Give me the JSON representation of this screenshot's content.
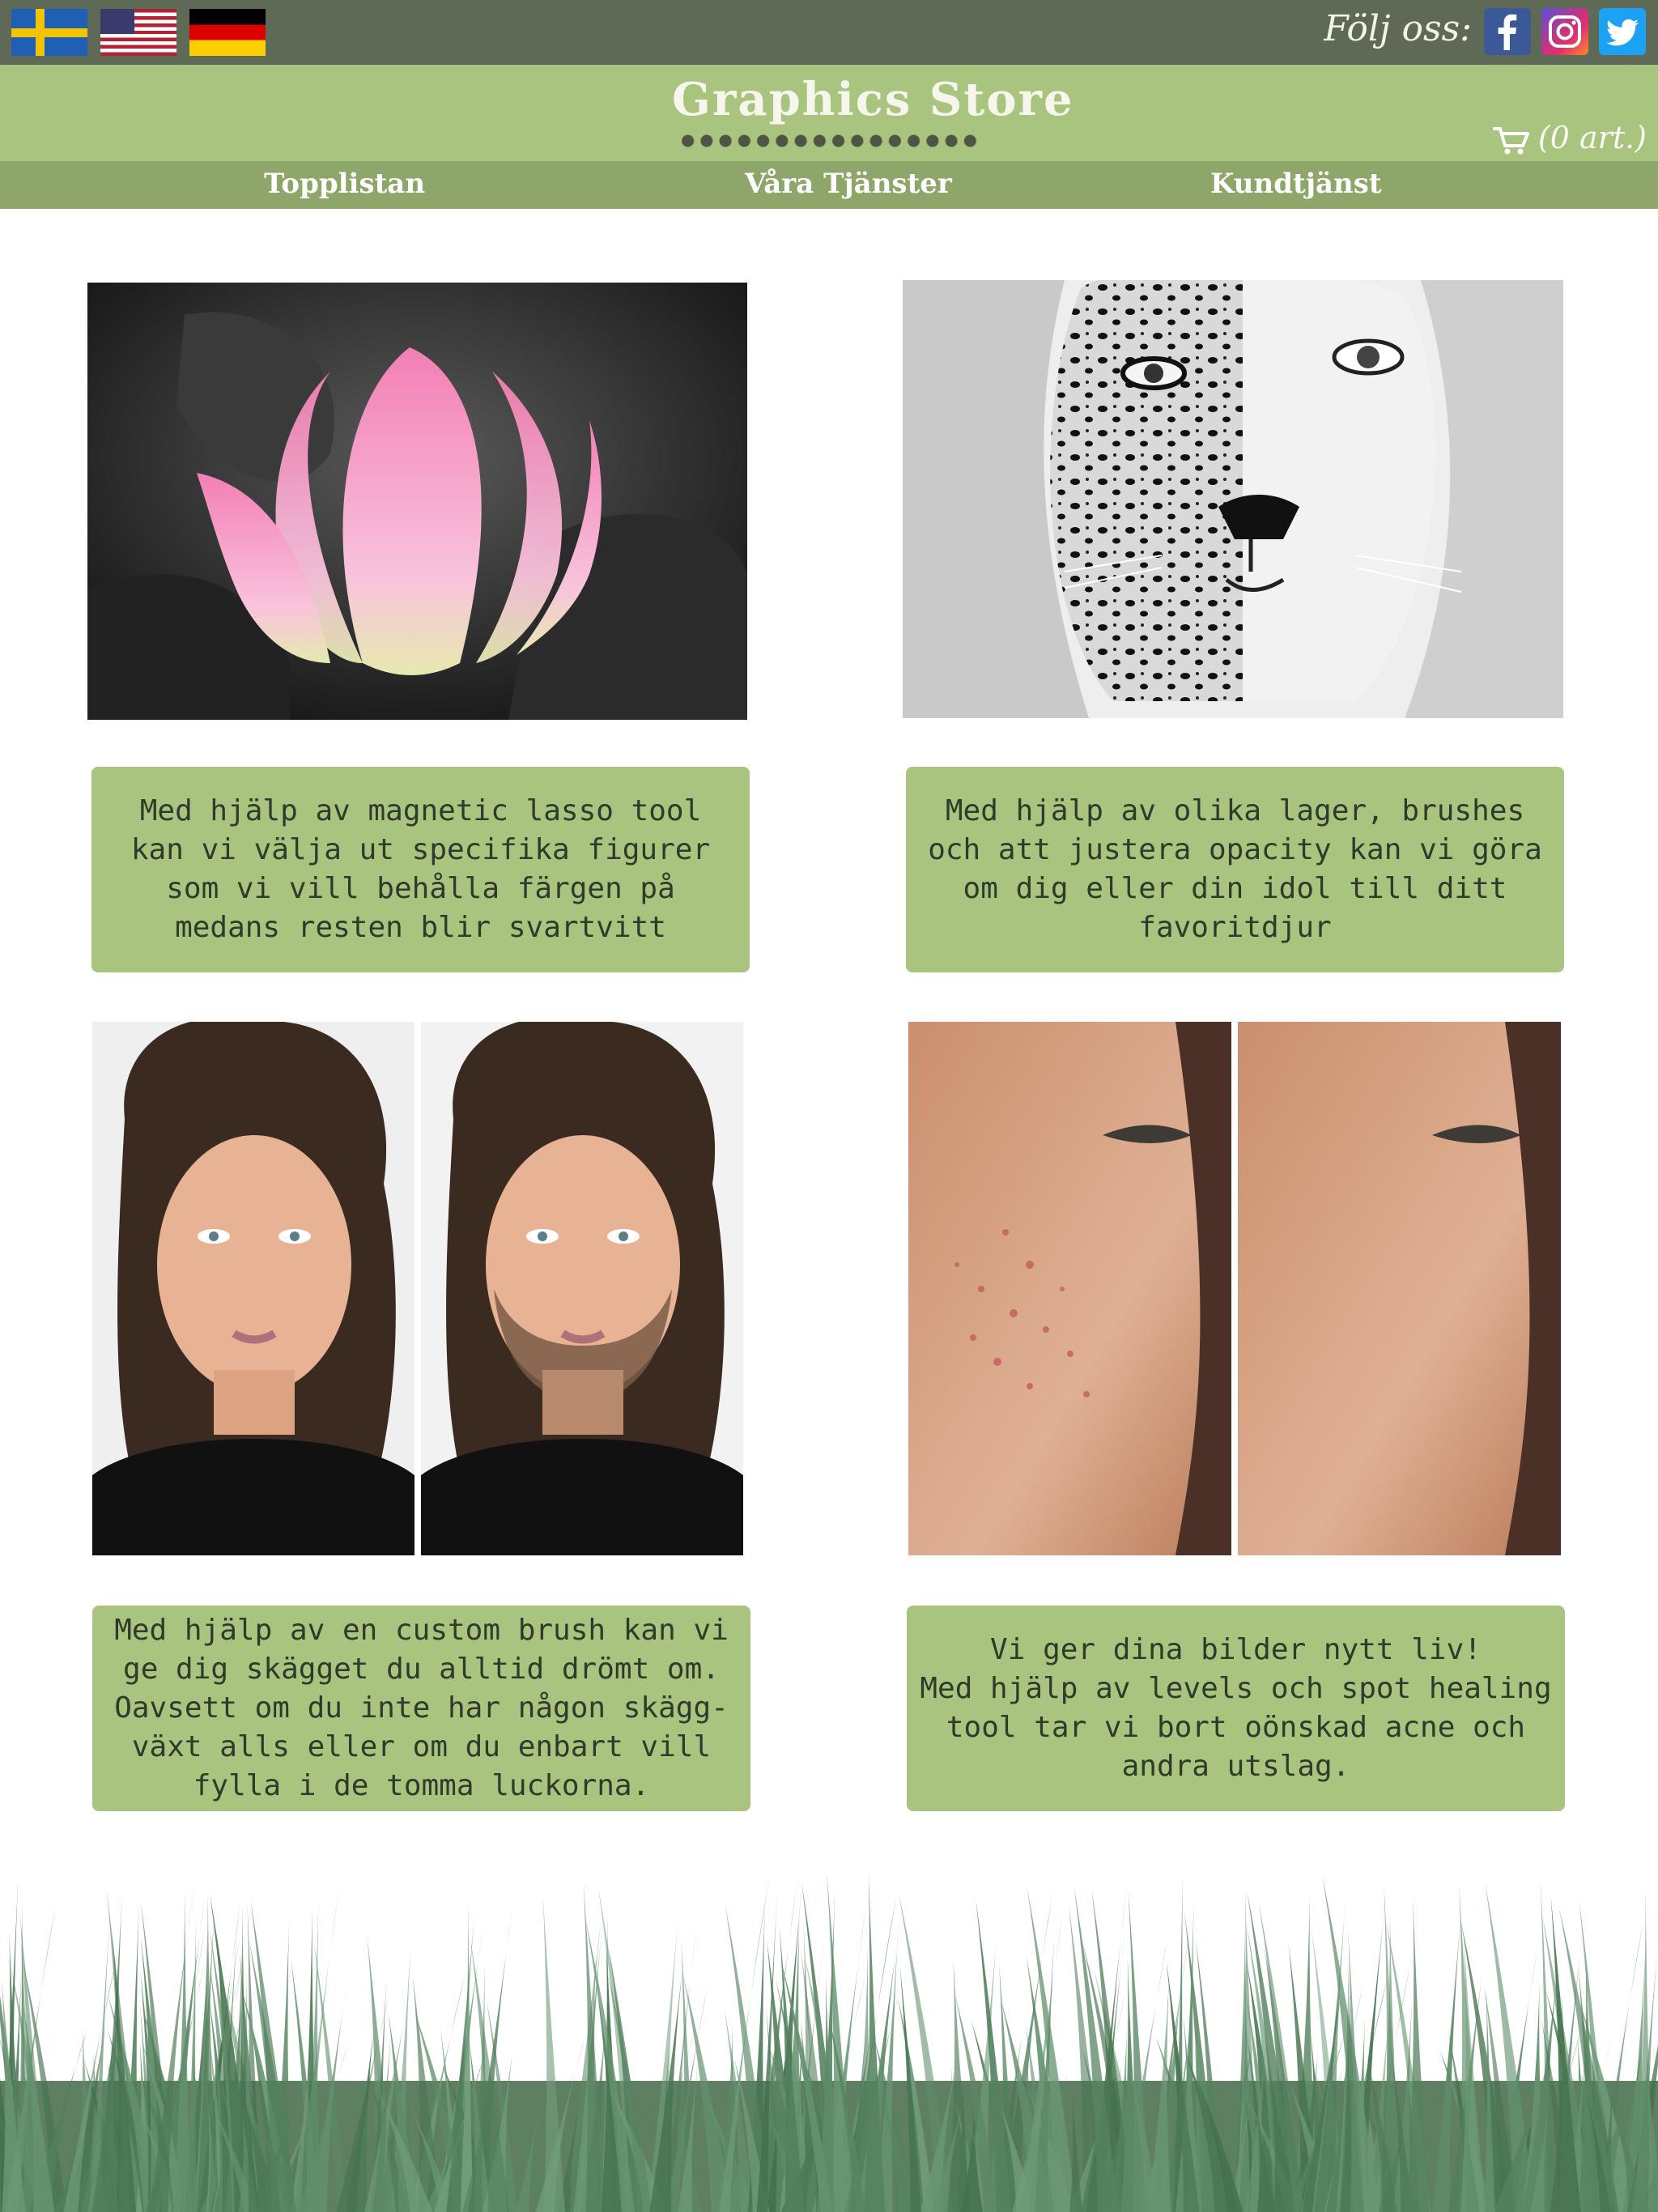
{
  "topbar": {
    "flags": [
      {
        "name": "Sverige",
        "icon": "flag-se-icon"
      },
      {
        "name": "USA",
        "icon": "flag-us-icon"
      },
      {
        "name": "Deutschland",
        "icon": "flag-de-icon"
      }
    ],
    "follow_label": "Följ oss:",
    "social": [
      "facebook-icon",
      "instagram-icon",
      "twitter-icon"
    ]
  },
  "header": {
    "logo": "Graphics Store",
    "cart": "(0 art.)"
  },
  "nav": {
    "items": [
      "Topplistan",
      "Våra Tjänster",
      "Kundtjänst"
    ]
  },
  "services": [
    {
      "caption": "Med hjälp av magnetic lasso tool\nkan vi välja ut specifika figurer\nsom vi vill behålla färgen på\nmedans resten blir svartvitt"
    },
    {
      "caption": "Med hjälp av olika lager, brushes\noch att justera opacity kan vi göra\nom dig eller din idol till ditt\nfavoritdjur"
    },
    {
      "caption": "Med hjälp av en custom brush kan vi\nge dig skägget du alltid drömt om.\nOavsett om du inte har någon skägg-\nväxt alls eller om du enbart vill\nfylla i de tomma luckorna."
    },
    {
      "caption": "Vi ger dina bilder nytt liv!\nMed hjälp av levels och spot healing\ntool tar vi bort oönskad acne och\nandra utslag."
    }
  ],
  "colors": {
    "topbar": "#5f6a56",
    "header": "#a9c47f",
    "nav": "#8ea669",
    "caption_bg": "#a9c47f",
    "grass": "#5f7f63"
  }
}
